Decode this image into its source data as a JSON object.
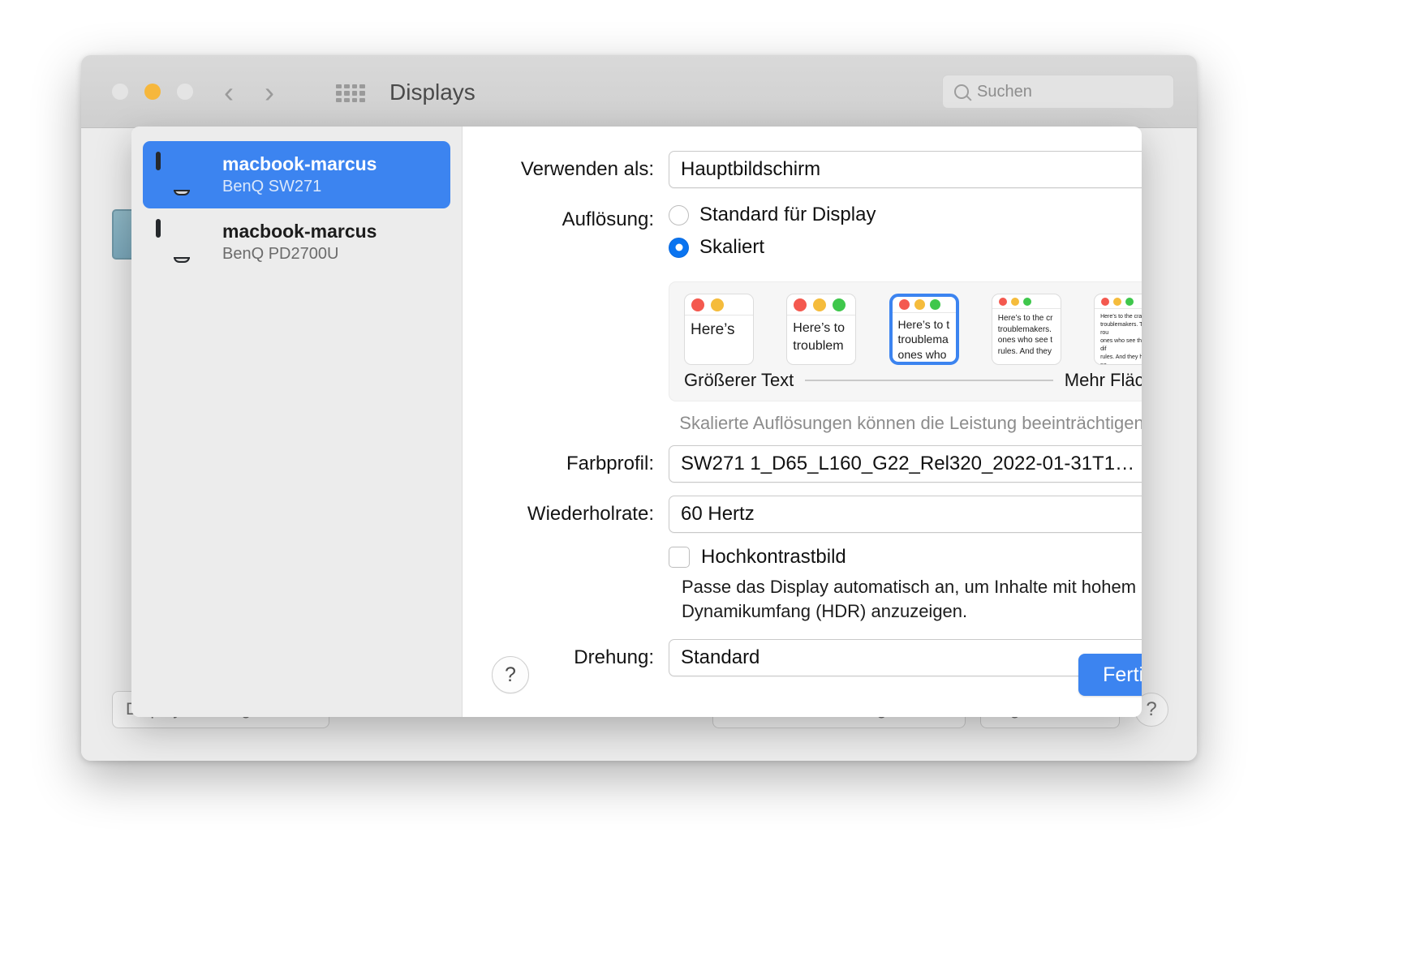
{
  "window": {
    "title": "Displays",
    "traffic_lights": [
      "close",
      "minimize",
      "zoom"
    ],
    "nav_back": "‹",
    "nav_forward": "›"
  },
  "search": {
    "placeholder": "Suchen"
  },
  "background": {
    "add_display_button": "Display hinzufügen",
    "screen_settings_button": "Bildschirmeinstellungen …",
    "night_shift_button": "Night Shift …",
    "help_button": "?"
  },
  "sidebar": {
    "displays": [
      {
        "name": "macbook-marcus",
        "model": "BenQ SW271",
        "selected": true
      },
      {
        "name": "macbook-marcus",
        "model": "BenQ PD2700U",
        "selected": false
      }
    ]
  },
  "form": {
    "use_as_label": "Verwenden als:",
    "use_as_value": "Hauptbildschirm",
    "resolution_label": "Auflösung:",
    "resolution_option_default": "Standard für Display",
    "resolution_option_scaled": "Skaliert",
    "resolution_selected": "Skaliert",
    "color_profile_label": "Farbprofil:",
    "color_profile_value": "SW271 1_D65_L160_G22_Rel320_2022-01-31T1…",
    "refresh_rate_label": "Wiederholrate:",
    "refresh_rate_value": "60 Hertz",
    "hdr_checkbox_label": "Hochkontrastbild",
    "hdr_checked": false,
    "hdr_description": "Passe das Display automatisch an, um Inhalte mit hohem Dynamikumfang (HDR) anzuzeigen.",
    "rotation_label": "Drehung:",
    "rotation_value": "Standard"
  },
  "scale": {
    "left_label": "Größerer Text",
    "right_label": "Mehr Fläche",
    "performance_note": "Skalierte Auflösungen können die Leistung beeinträchtigen.",
    "selected_index": 2,
    "thumbnails": [
      {
        "dots": [
          "r",
          "y"
        ],
        "text": "Here’s"
      },
      {
        "dots": [
          "r",
          "y",
          "g"
        ],
        "text": "Here’s to\ntroublem"
      },
      {
        "dots": [
          "r",
          "y",
          "g"
        ],
        "text": "Here’s to t\ntroublema\nones who"
      },
      {
        "dots": [
          "r",
          "y",
          "g"
        ],
        "text": "Here’s to the cr\ntroublemakers.\nones who see t\nrules. And they"
      },
      {
        "dots": [
          "r",
          "y",
          "g"
        ],
        "text": "Here’s to the crazy one\ntroublemakers. The rou\nones who see things dif\nrules. And they have no\ncan quote them, disagr\nthem. About the only th\nBecause they change th"
      }
    ]
  },
  "footer": {
    "help_label": "?",
    "done_label": "Fertig"
  },
  "colors": {
    "accent": "#3c84f0",
    "selection": "#3c84f0",
    "radio_on": "#0a74f0",
    "window_bg": "#ececec",
    "sheet_bg": "#ffffff"
  }
}
